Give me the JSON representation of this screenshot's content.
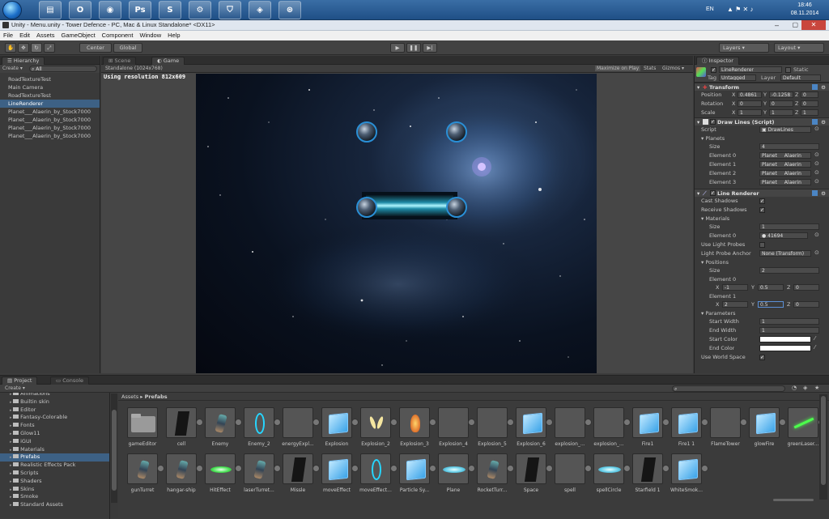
{
  "taskbar": {
    "pinned": [
      {
        "name": "explorer-icon",
        "glyph": "▤"
      },
      {
        "name": "opera-icon",
        "glyph": "O"
      },
      {
        "name": "firefox-icon",
        "glyph": "◉"
      },
      {
        "name": "photoshop-icon",
        "glyph": "Ps"
      },
      {
        "name": "skype-icon",
        "glyph": "S"
      },
      {
        "name": "steam-icon",
        "glyph": "⚙"
      },
      {
        "name": "shield-icon",
        "glyph": "⛉"
      },
      {
        "name": "unity-icon",
        "glyph": "◈"
      },
      {
        "name": "network-icon",
        "glyph": "⊛"
      }
    ],
    "lang": "EN",
    "time": "18:46",
    "date": "08.11.2014"
  },
  "window": {
    "title": "Unity - Menu.unity - Tower Defence - PC, Mac & Linux Standalone* <DX11>"
  },
  "menu": [
    "File",
    "Edit",
    "Assets",
    "GameObject",
    "Component",
    "Window",
    "Help"
  ],
  "toolbar": {
    "center": "Center",
    "global": "Global",
    "layers": "Layers",
    "layout": "Layout"
  },
  "hierarchy": {
    "tab": "Hierarchy",
    "create": "Create",
    "search_placeholder": "All",
    "items": [
      "RoadTextureTest",
      "Main Camera",
      "RoadTextureTest",
      "LineRenderer",
      "Planet___Alaerin_by_Stock7000",
      "Planet___Alaerin_by_Stock7000",
      "Planet___Alaerin_by_Stock7000",
      "Planet___Alaerin_by_Stock7000"
    ],
    "selected_index": 3
  },
  "game_view": {
    "tab_scene": "Scene",
    "tab_game": "Game",
    "resolution_dropdown": "Standalone (1024x768)",
    "maximize": "Maximize on Play",
    "stats": "Stats",
    "gizmos": "Gizmos",
    "resolution_text": "Using resolution 812x609"
  },
  "inspector": {
    "tab": "Inspector",
    "object_name": "LineRenderer",
    "static_label": "Static",
    "tag_label": "Tag",
    "tag_value": "Untagged",
    "layer_label": "Layer",
    "layer_value": "Default",
    "transform": {
      "title": "Transform",
      "rows": [
        {
          "label": "Position",
          "x": "0.4861",
          "y": "-0.1258",
          "z": "0"
        },
        {
          "label": "Rotation",
          "x": "0",
          "y": "0",
          "z": "0"
        },
        {
          "label": "Scale",
          "x": "1",
          "y": "1",
          "z": "1"
        }
      ]
    },
    "draw_lines": {
      "title": "Draw Lines (Script)",
      "script_label": "Script",
      "script_value": "DrawLines",
      "planets_label": "Planets",
      "size_label": "Size",
      "size_value": "4",
      "elements": [
        {
          "label": "Element 0",
          "value": "Planet___Alaerin"
        },
        {
          "label": "Element 1",
          "value": "Planet___Alaerin"
        },
        {
          "label": "Element 2",
          "value": "Planet___Alaerin"
        },
        {
          "label": "Element 3",
          "value": "Planet___Alaerin"
        }
      ]
    },
    "line_renderer": {
      "title": "Line Renderer",
      "cast_shadows": "Cast Shadows",
      "receive_shadows": "Receive Shadows",
      "materials": "Materials",
      "size_label": "Size",
      "mat_size": "1",
      "element0_label": "Element 0",
      "element0_value": "41694",
      "use_light_probes": "Use Light Probes",
      "light_probe_anchor": "Light Probe Anchor",
      "light_probe_value": "None (Transform)",
      "positions": "Positions",
      "pos_size": "2",
      "pos_elements": [
        {
          "label": "Element 0",
          "x": "-1",
          "y": "0.5",
          "z": "0"
        },
        {
          "label": "Element 1",
          "x": "2",
          "y": "0.5",
          "z": "0"
        }
      ],
      "parameters": "Parameters",
      "start_width_label": "Start Width",
      "start_width": "1",
      "end_width_label": "End Width",
      "end_width": "1",
      "start_color": "Start Color",
      "end_color": "End Color",
      "use_world_space": "Use World Space"
    }
  },
  "project": {
    "tab_project": "Project",
    "tab_console": "Console",
    "create": "Create",
    "folders": [
      "Animations",
      "Builtin skin",
      "Editor",
      "Fantasy-Colorable",
      "Fonts",
      "Glow11",
      "iGUI",
      "Materials",
      "Prefabs",
      "Realistic Effects Pack",
      "Scripts",
      "Shaders",
      "Skins",
      "Smoke",
      "Standard Assets"
    ],
    "selected_folder": "Prefabs",
    "breadcrumb_root": "Assets",
    "breadcrumb_current": "Prefabs",
    "assets_row1": [
      {
        "label": "gameEditor",
        "kind": "folder"
      },
      {
        "label": "cell",
        "kind": "dark"
      },
      {
        "label": "Enemy",
        "kind": "ship"
      },
      {
        "label": "Enemy_2",
        "kind": "ring"
      },
      {
        "label": "energyExpl...",
        "kind": "blank"
      },
      {
        "label": "Explosion",
        "kind": "cube"
      },
      {
        "label": "Explosion_2",
        "kind": "flame"
      },
      {
        "label": "Explosion_3",
        "kind": "fire"
      },
      {
        "label": "Explosion_4",
        "kind": "blank"
      },
      {
        "label": "Explosion_5",
        "kind": "blank"
      },
      {
        "label": "Explosion_6",
        "kind": "cube"
      },
      {
        "label": "explosion_...",
        "kind": "blank"
      },
      {
        "label": "explosion_...",
        "kind": "blank"
      },
      {
        "label": "Fire1",
        "kind": "cube"
      },
      {
        "label": "Fire1 1",
        "kind": "cube"
      },
      {
        "label": "FlameTower",
        "kind": "blank"
      },
      {
        "label": "glowFire",
        "kind": "cube"
      },
      {
        "label": "greenLaser...",
        "kind": "laser"
      }
    ],
    "assets_row2": [
      {
        "label": "gunTurret",
        "kind": "ship"
      },
      {
        "label": "hangar-ship",
        "kind": "ship"
      },
      {
        "label": "HitEffect",
        "kind": "glow"
      },
      {
        "label": "laserTurret...",
        "kind": "ship"
      },
      {
        "label": "Missle",
        "kind": "dark"
      },
      {
        "label": "moveEffect",
        "kind": "cube"
      },
      {
        "label": "moveEffect...",
        "kind": "ring"
      },
      {
        "label": "Particle Sy...",
        "kind": "cube"
      },
      {
        "label": "Plane",
        "kind": "plane"
      },
      {
        "label": "RocketTurr...",
        "kind": "ship"
      },
      {
        "label": "Space",
        "kind": "dark"
      },
      {
        "label": "spell",
        "kind": "blank"
      },
      {
        "label": "spellCircle",
        "kind": "plane"
      },
      {
        "label": "Starfield 1",
        "kind": "dark"
      },
      {
        "label": "WhiteSmok...",
        "kind": "cube"
      }
    ]
  }
}
